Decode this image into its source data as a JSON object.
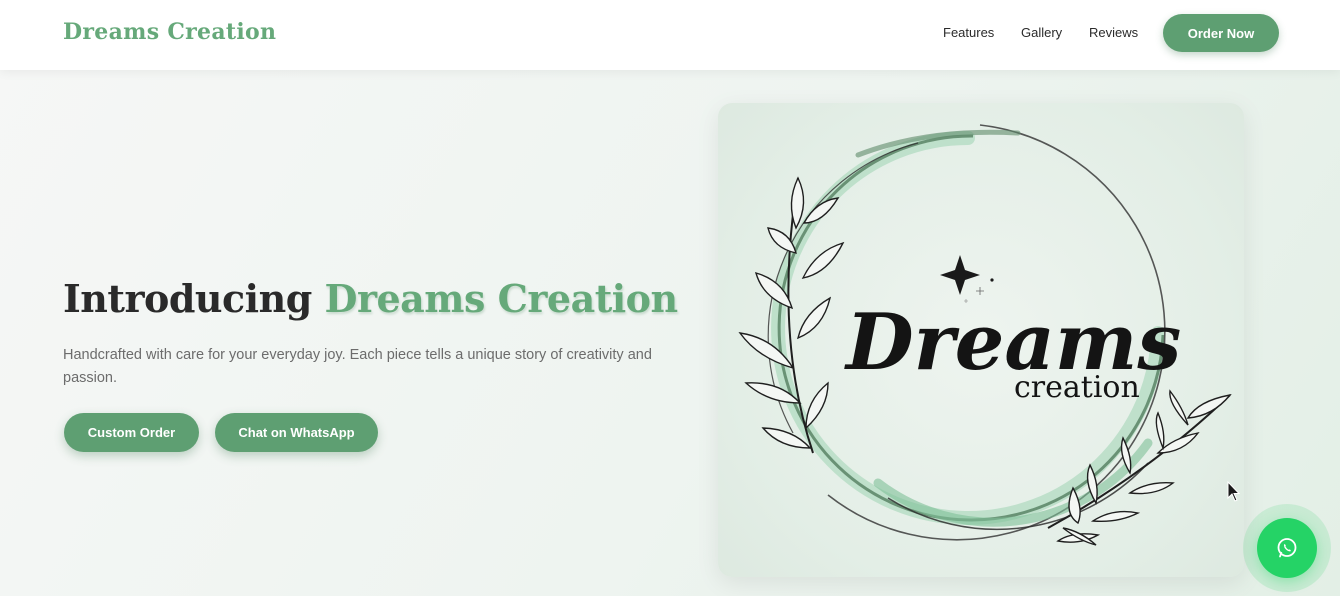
{
  "nav": {
    "brand": "Dreams Creation",
    "links": [
      "Features",
      "Gallery",
      "Reviews"
    ],
    "cta": "Order Now"
  },
  "hero": {
    "title_prefix": "Introducing",
    "title_accent": "Dreams Creation",
    "description": "Handcrafted with care for your everyday joy. Each piece tells a unique story of creativity and passion.",
    "buttons": [
      "Custom Order",
      "Chat on WhatsApp"
    ]
  },
  "logo": {
    "script": "Dreams",
    "sub": "creation"
  },
  "floating": {
    "icon": "whatsapp-icon"
  },
  "colors": {
    "accent": "#66a97a",
    "button": "#5e9f72",
    "whatsapp": "#25d366"
  }
}
